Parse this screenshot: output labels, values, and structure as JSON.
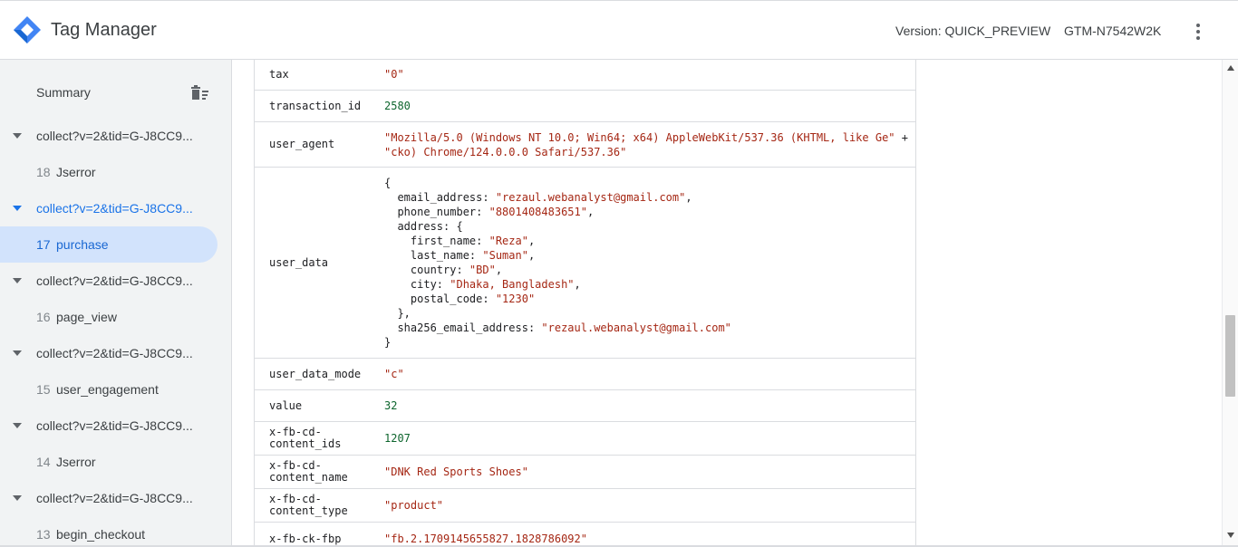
{
  "header": {
    "app_title": "Tag Manager",
    "version": "Version: QUICK_PREVIEW",
    "container_id": "GTM-N7542W2K",
    "brand_color": "#4285f4"
  },
  "sidebar": {
    "summary": "Summary",
    "rows": [
      {
        "type": "request",
        "label": "collect?v=2&tid=G-J8CC9...",
        "active": false
      },
      {
        "type": "event",
        "num": "18",
        "label": "Jserror",
        "selected": false
      },
      {
        "type": "request",
        "label": "collect?v=2&tid=G-J8CC9...",
        "active": true
      },
      {
        "type": "event",
        "num": "17",
        "label": "purchase",
        "selected": true
      },
      {
        "type": "request",
        "label": "collect?v=2&tid=G-J8CC9...",
        "active": false
      },
      {
        "type": "event",
        "num": "16",
        "label": "page_view",
        "selected": false
      },
      {
        "type": "request",
        "label": "collect?v=2&tid=G-J8CC9...",
        "active": false
      },
      {
        "type": "event",
        "num": "15",
        "label": "user_engagement",
        "selected": false
      },
      {
        "type": "request",
        "label": "collect?v=2&tid=G-J8CC9...",
        "active": false
      },
      {
        "type": "event",
        "num": "14",
        "label": "Jserror",
        "selected": false
      },
      {
        "type": "request",
        "label": "collect?v=2&tid=G-J8CC9...",
        "active": false
      },
      {
        "type": "event",
        "num": "13",
        "label": "begin_checkout",
        "selected": false
      }
    ]
  },
  "table": {
    "rows": [
      {
        "key": "tax",
        "lines": [
          [
            {
              "t": "\"0\"",
              "c": "str"
            }
          ]
        ]
      },
      {
        "key": "transaction_id",
        "lines": [
          [
            {
              "t": "2580",
              "c": "num"
            }
          ]
        ]
      },
      {
        "key": "user_agent",
        "lines": [
          [
            {
              "t": "\"Mozilla/5.0 (Windows NT 10.0; Win64; x64) AppleWebKit/537.36 (KHTML, like Ge\"",
              "c": "str"
            },
            {
              "t": " +",
              "c": ""
            }
          ],
          [
            {
              "t": "\"cko) Chrome/124.0.0.0 Safari/537.36\"",
              "c": "str"
            }
          ]
        ]
      },
      {
        "key": "user_data",
        "lines": [
          [
            {
              "t": "{",
              "c": ""
            }
          ],
          [
            {
              "t": "  email_address: ",
              "c": ""
            },
            {
              "t": "\"rezaul.webanalyst@gmail.com\"",
              "c": "str"
            },
            {
              "t": ",",
              "c": ""
            }
          ],
          [
            {
              "t": "  phone_number: ",
              "c": ""
            },
            {
              "t": "\"8801408483651\"",
              "c": "str"
            },
            {
              "t": ",",
              "c": ""
            }
          ],
          [
            {
              "t": "  address: {",
              "c": ""
            }
          ],
          [
            {
              "t": "    first_name: ",
              "c": ""
            },
            {
              "t": "\"Reza\"",
              "c": "str"
            },
            {
              "t": ",",
              "c": ""
            }
          ],
          [
            {
              "t": "    last_name: ",
              "c": ""
            },
            {
              "t": "\"Suman\"",
              "c": "str"
            },
            {
              "t": ",",
              "c": ""
            }
          ],
          [
            {
              "t": "    country: ",
              "c": ""
            },
            {
              "t": "\"BD\"",
              "c": "str"
            },
            {
              "t": ",",
              "c": ""
            }
          ],
          [
            {
              "t": "    city: ",
              "c": ""
            },
            {
              "t": "\"Dhaka, Bangladesh\"",
              "c": "str"
            },
            {
              "t": ",",
              "c": ""
            }
          ],
          [
            {
              "t": "    postal_code: ",
              "c": ""
            },
            {
              "t": "\"1230\"",
              "c": "str"
            }
          ],
          [
            {
              "t": "  },",
              "c": ""
            }
          ],
          [
            {
              "t": "  sha256_email_address: ",
              "c": ""
            },
            {
              "t": "\"rezaul.webanalyst@gmail.com\"",
              "c": "str"
            }
          ],
          [
            {
              "t": "}",
              "c": ""
            }
          ]
        ]
      },
      {
        "key": "user_data_mode",
        "lines": [
          [
            {
              "t": "\"c\"",
              "c": "str"
            }
          ]
        ]
      },
      {
        "key": "value",
        "lines": [
          [
            {
              "t": "32",
              "c": "num"
            }
          ]
        ]
      },
      {
        "key": "x-fb-cd-\ncontent_ids",
        "lines": [
          [
            {
              "t": "1207",
              "c": "num"
            }
          ]
        ]
      },
      {
        "key": "x-fb-cd-\ncontent_name",
        "lines": [
          [
            {
              "t": "\"DNK Red Sports Shoes\"",
              "c": "str"
            }
          ]
        ]
      },
      {
        "key": "x-fb-cd-\ncontent_type",
        "lines": [
          [
            {
              "t": "\"product\"",
              "c": "str"
            }
          ]
        ]
      },
      {
        "key": "x-fb-ck-fbp",
        "lines": [
          [
            {
              "t": "\"fb.2.1709145655827.1828786092\"",
              "c": "str"
            }
          ]
        ]
      }
    ]
  },
  "colors": {
    "string": "#a52714",
    "number": "#0d652d",
    "selected_bg": "#d2e3fc",
    "accent": "#1a73e8"
  }
}
